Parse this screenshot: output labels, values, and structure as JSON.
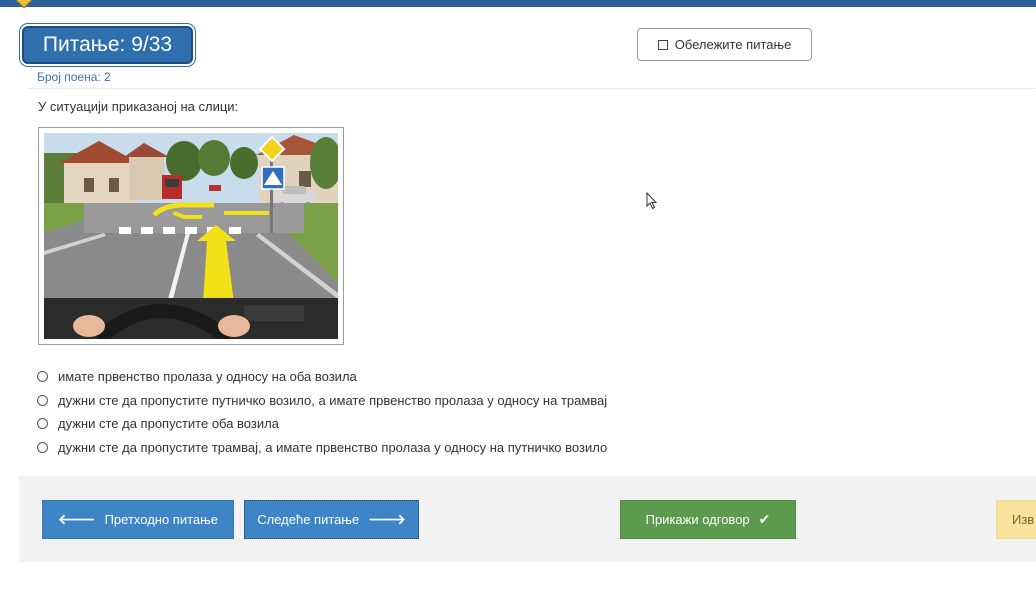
{
  "header": {
    "question_counter": "Питање: 9/33",
    "points": "Број поена: 2",
    "mark_question_label": "Обележите питање"
  },
  "question": {
    "prompt": "У ситуацији приказаној на слици:",
    "image": "road-intersection-with-tram-and-car",
    "options": [
      "имате првенство пролаза у односу на оба возила",
      "дужни сте да пропустите путничко возило, а имате првенство пролаза у односу на трамвај",
      "дужни сте да пропустите оба возила",
      "дужни сте да пропустите трамвај, а имате првенство пролаза у односу на путничко возило"
    ]
  },
  "footer": {
    "prev_label": "Претходно питање",
    "next_label": "Следеће питање",
    "show_answer_label": "Прикажи одговор",
    "finish_label": "Изв"
  },
  "colors": {
    "primary": "#3d85c6",
    "badge": "#2f6fad",
    "success": "#5c9a4d",
    "warning": "#f7e39b",
    "topbar": "#2d6099"
  }
}
